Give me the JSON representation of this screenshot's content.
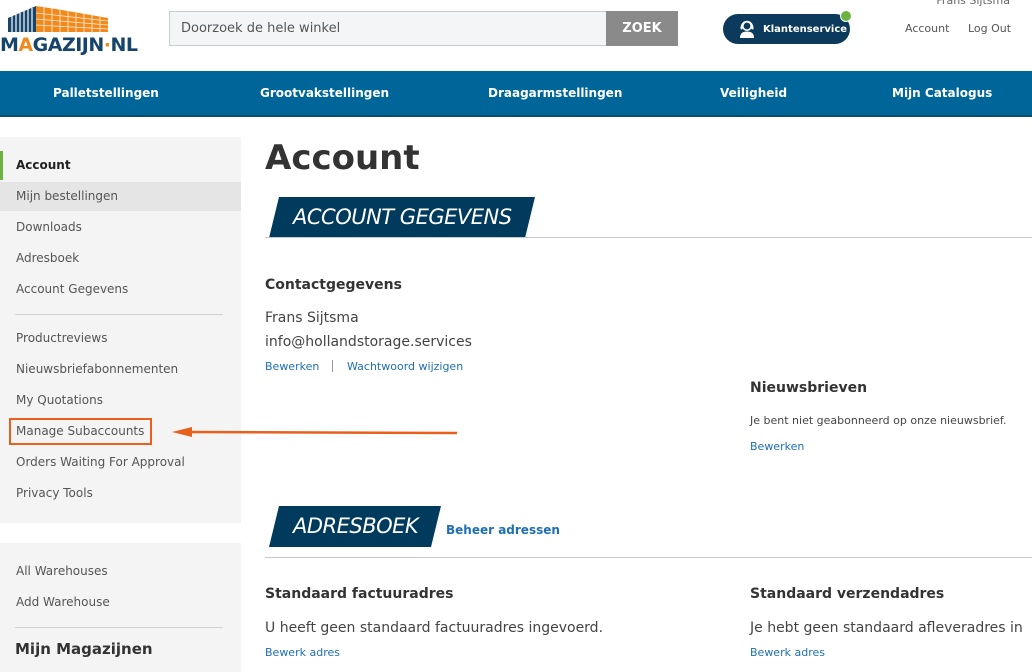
{
  "header": {
    "logo": {
      "text_prefix": "M",
      "text_accent": "A",
      "text_main": "GAZIJN",
      "text_dot": "·",
      "text_suffix": "NL"
    },
    "search": {
      "placeholder": "Doorzoek de hele winkel",
      "value": "",
      "button_label": "ZOEK"
    },
    "customer_service": {
      "label": "Klantenservice",
      "status_color": "#6cb33f",
      "icon": "headset-agent-icon"
    },
    "user_name": "Frans Sijtsma",
    "links": {
      "account": "Account",
      "logout": "Log Out"
    }
  },
  "nav": {
    "items": [
      {
        "label": "Palletstellingen"
      },
      {
        "label": "Grootvakstellingen"
      },
      {
        "label": "Draagarmstellingen"
      },
      {
        "label": "Veiligheid"
      },
      {
        "label": "Mijn Catalogus"
      }
    ],
    "color": "#006699"
  },
  "sidebar": {
    "group1": [
      {
        "label": "Account",
        "active": true
      },
      {
        "label": "Mijn bestellingen",
        "hover": true
      },
      {
        "label": "Downloads"
      },
      {
        "label": "Adresboek"
      },
      {
        "label": "Account Gegevens"
      }
    ],
    "group2": [
      {
        "label": "Productreviews"
      },
      {
        "label": "Nieuwsbriefabonnementen"
      },
      {
        "label": "My Quotations"
      },
      {
        "label": "Manage Subaccounts",
        "highlighted": true
      },
      {
        "label": "Orders Waiting For Approval"
      },
      {
        "label": "Privacy Tools"
      }
    ],
    "group3": [
      {
        "label": "All Warehouses"
      },
      {
        "label": "Add Warehouse"
      }
    ],
    "group3_title": "Mijn Magazijnen",
    "annotation_color": "#e8601c"
  },
  "main": {
    "title": "Account",
    "account_section": {
      "tag": "ACCOUNT GEGEVENS",
      "contact": {
        "title": "Contactgegevens",
        "name": "Frans Sijtsma",
        "email": "info@hollandstorage.services",
        "edit_link": "Bewerken",
        "password_link": "Wachtwoord wijzigen"
      },
      "newsletter": {
        "title": "Nieuwsbrieven",
        "text": "Je bent niet geabonneerd op onze nieuwsbrief.",
        "edit_link": "Bewerken"
      }
    },
    "address_section": {
      "tag": "ADRESBOEK",
      "manage_link": "Beheer adressen",
      "billing": {
        "title": "Standaard factuuradres",
        "text": "U heeft geen standaard factuuradres ingevoerd.",
        "edit_link": "Bewerk adres"
      },
      "shipping": {
        "title": "Standaard verzendadres",
        "text": "Je hebt geen standaard afleveradres in",
        "edit_link": "Bewerk adres"
      }
    }
  }
}
